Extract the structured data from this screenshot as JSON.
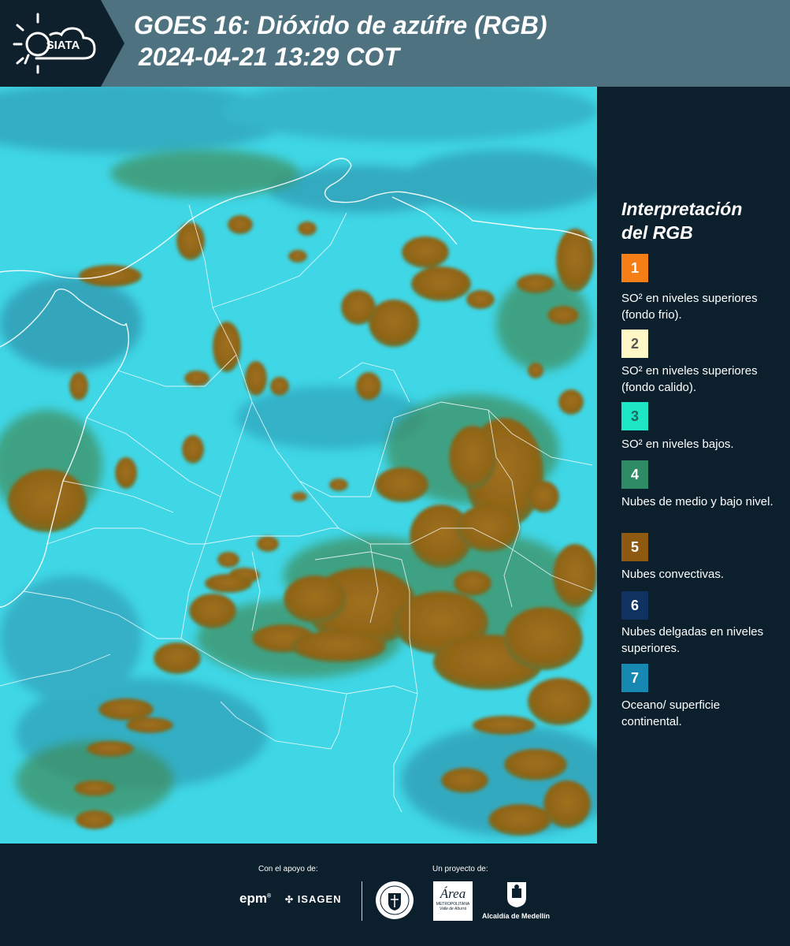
{
  "header": {
    "logo_text": "SIATA",
    "title_line1": "GOES 16: Dióxido de azúfre (RGB)",
    "title_line2": "2024-04-21 13:29 COT"
  },
  "legend": {
    "title_line1": "Interpretación",
    "title_line2": "del RGB",
    "items": [
      {
        "num": "1",
        "color": "#f57f16",
        "text_color": "#ffffff",
        "label": "SO² en niveles superiores (fondo frio)."
      },
      {
        "num": "2",
        "color": "#fff8c6",
        "text_color": "#555555",
        "label": "SO² en niveles superiores (fondo calido)."
      },
      {
        "num": "3",
        "color": "#1de6c4",
        "text_color": "#1b6a5c",
        "label": "SO² en niveles bajos."
      },
      {
        "num": "4",
        "color": "#2f8a66",
        "text_color": "#ffffff",
        "label": "Nubes de medio y bajo nivel."
      },
      {
        "num": "5",
        "color": "#8e5a11",
        "text_color": "#ffffff",
        "label": "Nubes convectivas."
      },
      {
        "num": "6",
        "color": "#0f3261",
        "text_color": "#ffffff",
        "label": "Nubes delgadas en niveles superiores."
      },
      {
        "num": "7",
        "color": "#1688b2",
        "text_color": "#ffffff",
        "label": "Oceano/ superficie continental."
      }
    ]
  },
  "footer": {
    "support_label": "Con el apoyo de:",
    "project_label": "Un proyecto de:",
    "epm": "epm",
    "isagen": "ISAGEN",
    "area_word": "Área",
    "area_sub1": "METROPOLITANA",
    "area_sub2": "Valle de Aburrá",
    "alcaldia": "Alcaldía de Medellín"
  },
  "colors": {
    "sky": "#3ed8e8",
    "cloud": "#9a6a1a",
    "cloud_edge": "#4f7a3a",
    "deep": "#1b5e7a",
    "border": "#ffffff"
  }
}
